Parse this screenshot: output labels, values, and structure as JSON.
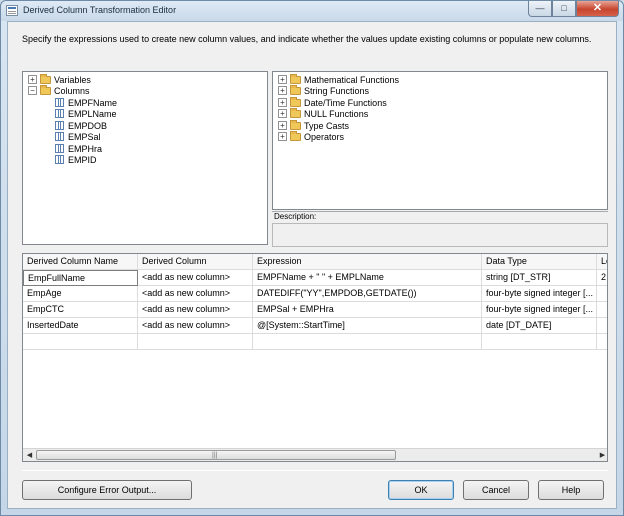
{
  "window": {
    "title": "Derived Column Transformation Editor",
    "close_glyph": "✕",
    "min_glyph": "—",
    "max_glyph": "□"
  },
  "instructions": "Specify the expressions used to create new column values, and indicate whether the values update existing columns or populate new columns.",
  "left_tree": {
    "variables_label": "Variables",
    "columns_label": "Columns",
    "columns": [
      "EMPFName",
      "EMPLName",
      "EMPDOB",
      "EMPSal",
      "EMPHra",
      "EMPID"
    ]
  },
  "right_tree": {
    "items": [
      "Mathematical Functions",
      "String Functions",
      "Date/Time Functions",
      "NULL Functions",
      "Type Casts",
      "Operators"
    ]
  },
  "expander_plus": "+",
  "expander_minus": "−",
  "description_label": "Description:",
  "grid": {
    "headers": [
      "Derived Column Name",
      "Derived Column",
      "Expression",
      "Data Type",
      "Le"
    ],
    "rows": [
      [
        "EmpFullName",
        "<add as new column>",
        "EMPFName + \" \" + EMPLName",
        "string [DT_STR]",
        "2"
      ],
      [
        "EmpAge",
        "<add as new column>",
        "DATEDIFF(\"YY\",EMPDOB,GETDATE())",
        "four-byte signed integer [...",
        ""
      ],
      [
        "EmpCTC",
        "<add as new column>",
        "EMPSal + EMPHra",
        "four-byte signed integer [...",
        ""
      ],
      [
        "InsertedDate",
        "<add as new column>",
        "@[System::StartTime]",
        "date [DT_DATE]",
        ""
      ]
    ],
    "scroll_left": "◀",
    "scroll_right": "▶",
    "thumb_grip": "|||"
  },
  "buttons": {
    "configure_error": "Configure Error Output...",
    "ok": "OK",
    "cancel": "Cancel",
    "help": "Help"
  },
  "colors": {
    "selection_border": "#7d7d7d",
    "close_button": "#c8452e",
    "default_button_border": "#3c7fb1"
  }
}
